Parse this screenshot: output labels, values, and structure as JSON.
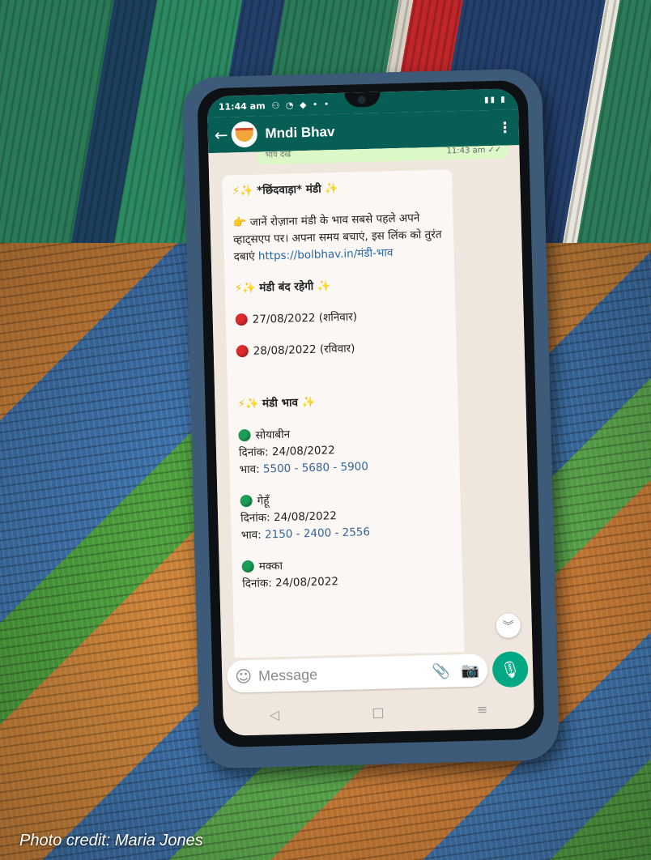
{
  "status": {
    "time": "11:44 am"
  },
  "app": {
    "title": "Mndi Bhav"
  },
  "prev_message": {
    "text": "भाव देखें",
    "time": "11:43 am"
  },
  "message": {
    "heading": "*छिंदवाड़ा* मंडी",
    "promo_prefix": "जानें रोज़ाना मंडी के भाव सबसे पहले अपने व्हाट्सएप पर। अपना समय बचाएं, इस लिंक को तुरंत दबाएं",
    "promo_link": "https://bolbhav.in/मंडी-भाव",
    "closed_heading": "मंडी बंद रहेगी",
    "closed_dates": [
      "27/08/2022 (शनिवार)",
      "28/08/2022 (रविवार)"
    ],
    "rates_heading": "मंडी भाव",
    "date_label": "दिनांक:",
    "price_label": "भाव:",
    "items": [
      {
        "name": "सोयाबीन",
        "date": "24/08/2022",
        "price": "5500 - 5680 - 5900"
      },
      {
        "name": "गेहूँ",
        "date": "24/08/2022",
        "price": "2150 - 2400 - 2556"
      },
      {
        "name": "मक्का",
        "date": "24/08/2022"
      }
    ]
  },
  "input": {
    "placeholder": "Message"
  },
  "credit": "Photo credit: Maria Jones",
  "icons": {
    "back": "arrow-left-icon",
    "menu": "more-vert-icon",
    "emoji": "emoji-icon",
    "attach": "paperclip-icon",
    "camera": "camera-icon",
    "mic": "mic-icon",
    "scroll": "chevron-double-down-icon"
  },
  "colors": {
    "header": "#075e54",
    "mic": "#00a884",
    "chat_bg": "#efe6dd",
    "link": "#2767a8"
  }
}
